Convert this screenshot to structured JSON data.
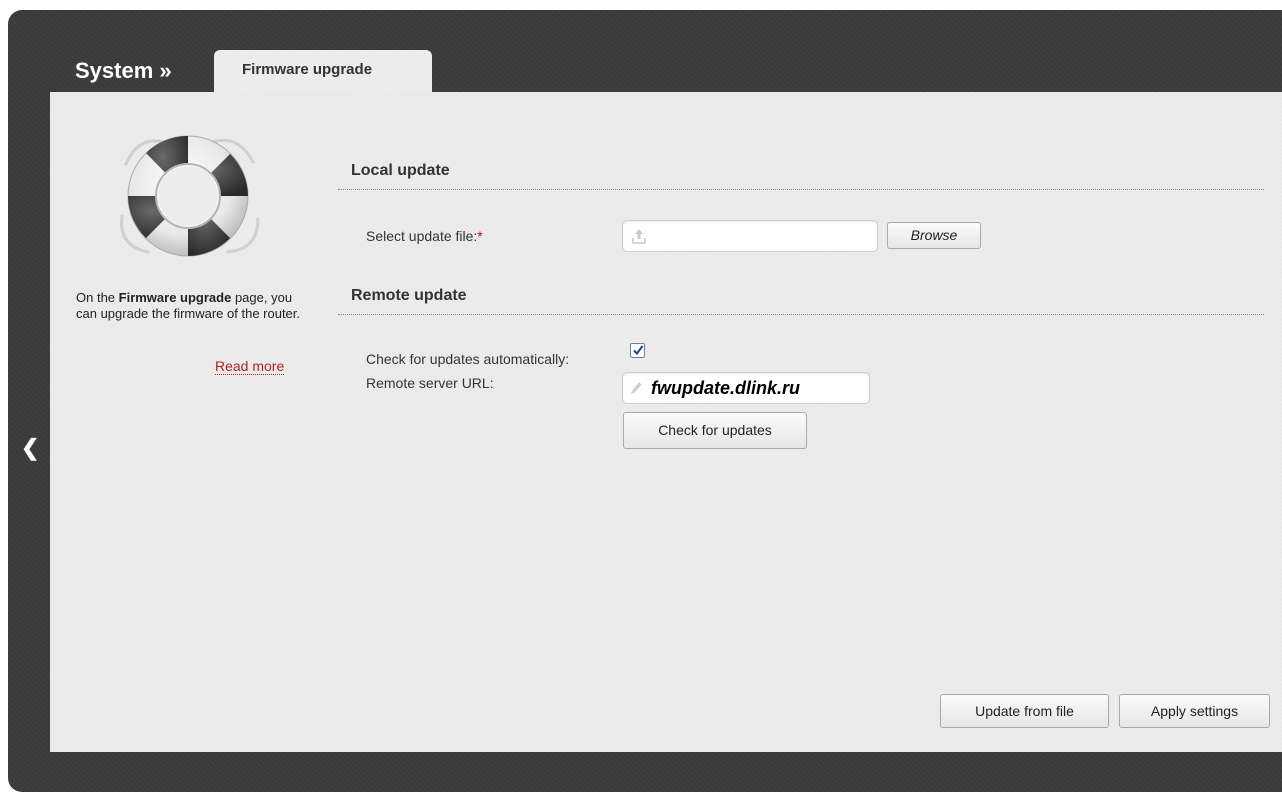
{
  "breadcrumb": {
    "section": "System »",
    "tab": "Firmware upgrade"
  },
  "info": {
    "prefix": "On the ",
    "page_name": "Firmware upgrade",
    "suffix": " page, you can upgrade the firmware of the router.",
    "read_more": "Read more"
  },
  "local_update": {
    "title": "Local update",
    "file_label": "Select update file:",
    "required_mark": "*",
    "file_value": "",
    "browse_button": "Browse"
  },
  "remote_update": {
    "title": "Remote update",
    "auto_check_label": "Check for updates automatically:",
    "auto_check_checked": true,
    "url_label": "Remote server URL:",
    "url_value": "fwupdate.dlink.ru",
    "check_button": "Check for updates"
  },
  "footer": {
    "update_from_file_button": "Update from file",
    "apply_settings_button": "Apply settings"
  },
  "icons": {
    "back": "chevron-left-icon",
    "hero": "lifebuoy-icon",
    "upload": "upload-icon",
    "edit": "pencil-icon",
    "check": "checkmark-icon"
  },
  "colors": {
    "frame": "#3a3a3a",
    "panel": "#ececec",
    "link": "#b22222",
    "required": "#cc0000"
  }
}
